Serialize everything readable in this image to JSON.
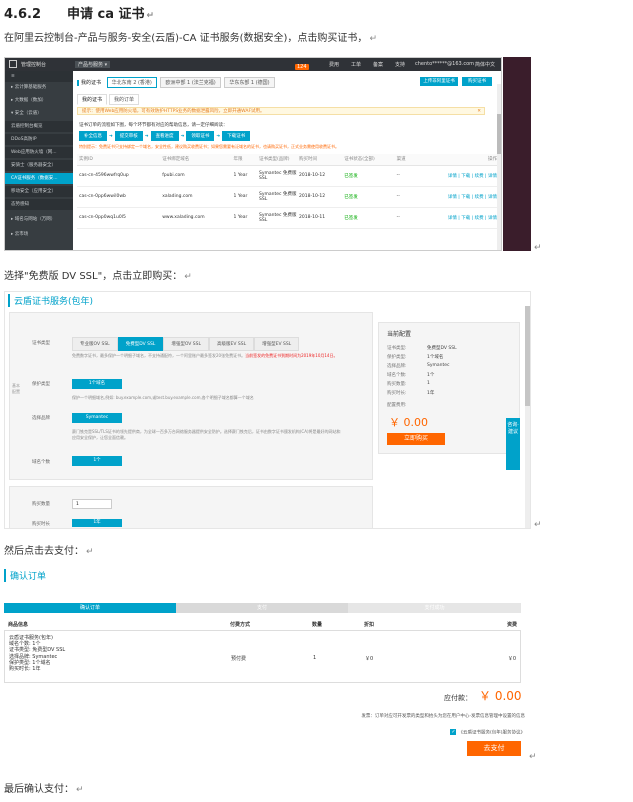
{
  "heading": {
    "number": "4.6.2",
    "title": "申请 ca 证书"
  },
  "para1": "在阿里云控制台-产品与服务-安全(云盾)-CA 证书服务(数据安全)，点击购买证书，",
  "para2": "选择\"免费版 DV SSL\"，点击立即购买：",
  "para3": "然后点击去支付：",
  "para4": "最后确认支付：",
  "para_mark": "↵",
  "console": {
    "topbar": {
      "console_label": "管理控制台",
      "products_label": "产品与服务 ▾",
      "msg_label": "消息",
      "msg_count": "124",
      "links": [
        "费用",
        "工单",
        "备案",
        "支持"
      ],
      "account": "chento******@163.com",
      "lang": "简体中文"
    },
    "sidebar": [
      {
        "label": "≡",
        "kind": "sec"
      },
      {
        "label": "▸ 云计算基础服务",
        "kind": "grp"
      },
      {
        "label": "▸ 大数据（数加）",
        "kind": "grp"
      },
      {
        "label": "▾ 安全（云盾）",
        "kind": "grp"
      },
      {
        "label": "云盾控制台概览",
        "kind": "sec"
      },
      {
        "label": "DDoS高防IP",
        "kind": "sec"
      },
      {
        "label": "Web应用防火墙（网...",
        "kind": "sec"
      },
      {
        "label": "安骑士（服务器安全）",
        "kind": "sec"
      },
      {
        "label": "CA证书服务（数据安...",
        "kind": "act"
      },
      {
        "label": "移动安全（应用安全）",
        "kind": "sec"
      },
      {
        "label": "态势感知",
        "kind": "sec"
      },
      {
        "label": "▸ 域名与网站（万网）",
        "kind": "grp"
      },
      {
        "label": "▸ 云市场",
        "kind": "grp"
      }
    ],
    "region_tabs": [
      "华北东南 2 (香港)",
      "欧洲中部 1 (法兰克福)",
      "华东东部 1 (德国)"
    ],
    "my_cert_label": "我的证书",
    "upload_button": "上传非阿里证书",
    "buy_button": "购买证书",
    "subtabs": [
      "我的证书",
      "我的订单"
    ],
    "notice": "提示：使用Web应用防火墙，可有效防护HTTPS业务的数据泄露风险，立即开通WAF试用。",
    "notice_close": "✕",
    "step_text": "证书订单的流程如下图，每个环节都有对应的帮助信息，请一定仔细阅读：",
    "steps": [
      "补全信息",
      "提交审核",
      "查看进度",
      "领取证书",
      "下载证书"
    ],
    "warning": "特别提示：免费证书只支持绑定一个域名，安全性低，建议购买收费证书；如果您需要有泛域名的证书，也请购买证书，正式业务需使用收费证书。",
    "table": {
      "headers": [
        "实例ID",
        "证书绑定域名",
        "年限",
        "证书类型(品牌)",
        "购买时间",
        "证书状态(全部)",
        "渠道",
        "操作"
      ],
      "rows": [
        [
          "cas-cn-4596wwfrq0up",
          "fpubi.com",
          "1 Year",
          "Symantec 免费版 SSL",
          "2018-10-12",
          "已签发",
          "--",
          "详情 | 下载 | 续费 | 详情"
        ],
        [
          "cas-cn-0pp6wwil0wb",
          "xalading.com",
          "1 Year",
          "Symantec 免费版 SSL",
          "2018-10-12",
          "已签发",
          "--",
          "详情 | 下载 | 续费 | 详情"
        ],
        [
          "cas-cn-0pp0wq1u0l5",
          "www.xalading.com",
          "1 Year",
          "Symantec 免费版 SSL",
          "2018-10-11",
          "已签发",
          "--",
          "详情 | 下载 | 续费 | 详情"
        ]
      ]
    }
  },
  "ssl": {
    "title": "云盾证书服务(包年)",
    "side_vertical": "基本配置",
    "labels": {
      "cert_type": "证书类型",
      "protect_type": "保护类型",
      "brand": "选择品牌",
      "domain_count": "域名个数",
      "buy_count": "购买数量",
      "buy_time": "购买时长"
    },
    "types": [
      "专业版OV SSL",
      "免费型DV SSL",
      "增强型OV SSL",
      "高级版EV SSL",
      "增强型EV SSL"
    ],
    "cert_desc_prefix": "免费数字证书，最多保护一个明细子域名，不支持通配符，一个阿里账户最多签发20张免费证书。",
    "cert_desc_red": "当前签发的免费证书到期时间为2019年10月14日。",
    "protect_chip": "1个域名",
    "protect_desc": "保护一个明细域名,例如: buy.example.com,或test.buy.example.com,各个明细子域名都算一个域名",
    "brand_chip": "Symantec",
    "brand_desc": "赛门铁克是SSL/TLS证书的领先提供商，为全球一百多万台网络服务器提供安全防护。选择赛门铁克后，证书由数字证书颁发机构(CA)将是最好的网站和应用安全保护，让您全面信赖。",
    "domain_chip": "1个",
    "qty_value": "1",
    "time_chip": "1年",
    "config": {
      "title": "当前配置",
      "rows": [
        [
          "证书类型:",
          "免费型DV SSL"
        ],
        [
          "保护类型:",
          "1个域名"
        ],
        [
          "选择品牌:",
          "Symantec"
        ],
        [
          "域名个数:",
          "1个"
        ],
        [
          "购买数量:",
          "1"
        ],
        [
          "购买时长:",
          "1年"
        ],
        [
          "配置费用:",
          ""
        ]
      ],
      "price": "￥ 0.00",
      "buy_now": "立即购买"
    },
    "feedback": "咨询·建议"
  },
  "order": {
    "title": "确认订单",
    "progress": [
      "确认订单",
      "支付",
      "支付成功"
    ],
    "headers": [
      "商品信息",
      "付费方式",
      "数量",
      "折扣",
      "资费"
    ],
    "product_lines": [
      "云盾证书服务(包年)",
      "域名个数: 1个",
      "证书类型: 免费型DV SSL",
      "选择品牌: Symantec",
      "保护类型: 1个域名",
      "购买时长: 1年"
    ],
    "pay_method": "预付费",
    "quantity": "1",
    "discount": "￥0",
    "fee": "￥0",
    "due_label": "应付款：",
    "due_value": "￥ 0.00",
    "invoice_note": "发票：订单对应可开发票的类型和抬头为您在用户中心-发票信息管理中设置的信息",
    "agree_text": "《云盾证书服务(包年)服务协议》",
    "pay_button": "去支付"
  }
}
